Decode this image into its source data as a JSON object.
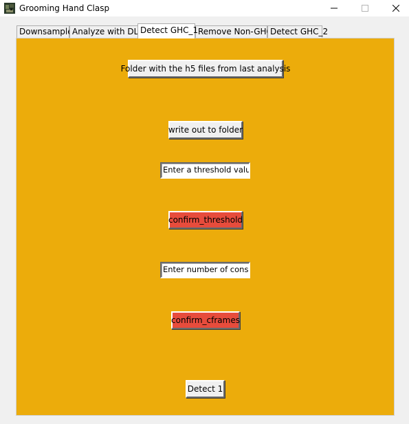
{
  "window": {
    "title": "Grooming Hand Clasp",
    "minimize_glyph": "–",
    "maximize_glyph": "☐",
    "close_glyph": "✕"
  },
  "tabs": [
    {
      "label": "Downsample"
    },
    {
      "label": "Analyze with DLC"
    },
    {
      "label": "Detect GHC_1"
    },
    {
      "label": "Remove Non-GHC"
    },
    {
      "label": "Detect GHC_2"
    }
  ],
  "active_tab": "Detect GHC_1",
  "panel": {
    "background_color": "#ecac0b",
    "folder_button_label": "Folder with the h5 files from last analysis",
    "write_out_button_label": "write out to folder",
    "threshold_entry_value": "Enter a threshold value",
    "confirm_threshold_label": "confirm_threshold",
    "cframes_entry_value": "Enter number of conse",
    "confirm_cframes_label": "confirm_cframes",
    "detect_button_label": "Detect 1",
    "confirm_button_color": "#e74c3c"
  }
}
